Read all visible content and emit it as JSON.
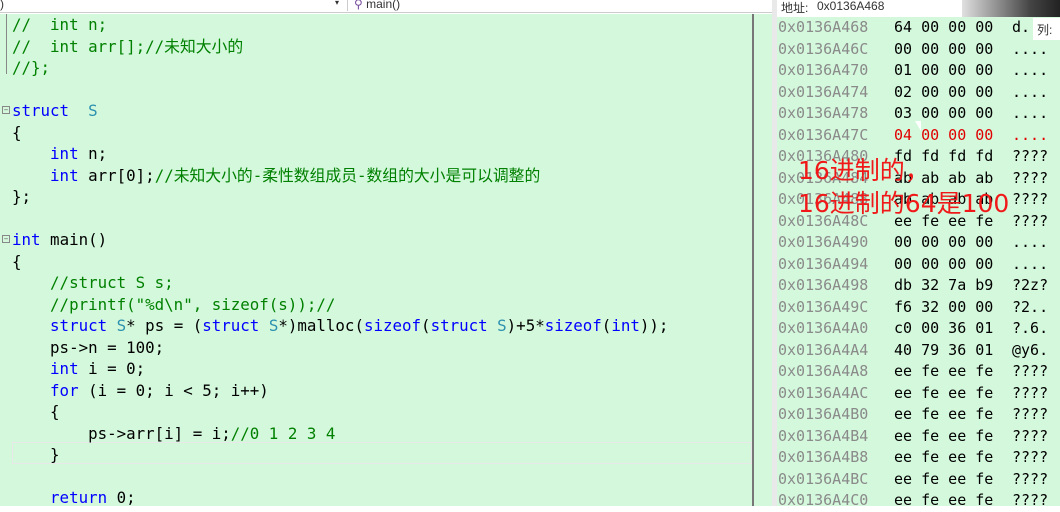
{
  "nav": {
    "left_value": ")",
    "right_value": "main()"
  },
  "code": [
    [
      [
        "cm",
        "//  int n;"
      ]
    ],
    [
      [
        "cm",
        "//  int arr[];//未知大小的"
      ]
    ],
    [
      [
        "cm",
        "//};"
      ]
    ],
    [],
    [
      [
        "kw",
        "struct"
      ],
      [
        "",
        "  "
      ],
      [
        "ty",
        "S"
      ]
    ],
    [
      [
        "",
        "{"
      ]
    ],
    [
      [
        "",
        "    "
      ],
      [
        "kw",
        "int"
      ],
      [
        "",
        " n;"
      ]
    ],
    [
      [
        "",
        "    "
      ],
      [
        "kw",
        "int"
      ],
      [
        "",
        " arr[0];"
      ],
      [
        "cm",
        "//未知大小的-柔性数组成员-数组的大小是可以调整的"
      ]
    ],
    [
      [
        "",
        "};"
      ]
    ],
    [],
    [
      [
        "kw",
        "int"
      ],
      [
        "",
        " main()"
      ]
    ],
    [
      [
        "",
        "{"
      ]
    ],
    [
      [
        "",
        "    "
      ],
      [
        "cm",
        "//struct S s;"
      ]
    ],
    [
      [
        "",
        "    "
      ],
      [
        "cm",
        "//printf(\"%d\\n\", sizeof(s));//"
      ]
    ],
    [
      [
        "",
        "    "
      ],
      [
        "kw",
        "struct"
      ],
      [
        "",
        " "
      ],
      [
        "ty",
        "S"
      ],
      [
        "",
        "* ps = ("
      ],
      [
        "kw",
        "struct"
      ],
      [
        "",
        " "
      ],
      [
        "ty",
        "S"
      ],
      [
        "",
        "*)malloc("
      ],
      [
        "kw",
        "sizeof"
      ],
      [
        "",
        "("
      ],
      [
        "kw",
        "struct"
      ],
      [
        "",
        " "
      ],
      [
        "ty",
        "S"
      ],
      [
        "",
        ")+5*"
      ],
      [
        "kw",
        "sizeof"
      ],
      [
        "",
        "("
      ],
      [
        "kw",
        "int"
      ],
      [
        "",
        "));"
      ]
    ],
    [
      [
        "",
        "    ps->n = 100;"
      ]
    ],
    [
      [
        "",
        "    "
      ],
      [
        "kw",
        "int"
      ],
      [
        "",
        " i = 0;"
      ]
    ],
    [
      [
        "",
        "    "
      ],
      [
        "kw",
        "for"
      ],
      [
        "",
        " (i = 0; i < 5; i++)"
      ]
    ],
    [
      [
        "",
        "    {"
      ]
    ],
    [
      [
        "",
        "        ps->arr[i] = i;"
      ],
      [
        "cm",
        "//0 1 2 3 4"
      ]
    ],
    [
      [
        "",
        "    }"
      ]
    ],
    [],
    [
      [
        "",
        "    "
      ],
      [
        "kw",
        "return"
      ],
      [
        "",
        " 0;"
      ]
    ]
  ],
  "memory": {
    "address_label": "地址:",
    "address_value": "0x0136A468",
    "column_label": "列:",
    "rows": [
      {
        "addr": "0x0136A468",
        "hex": "64 00 00 00",
        "ascii": "d..."
      },
      {
        "addr": "0x0136A46C",
        "hex": "00 00 00 00",
        "ascii": "...."
      },
      {
        "addr": "0x0136A470",
        "hex": "01 00 00 00",
        "ascii": "...."
      },
      {
        "addr": "0x0136A474",
        "hex": "02 00 00 00",
        "ascii": "...."
      },
      {
        "addr": "0x0136A478",
        "hex": "03 00 00 00",
        "ascii": "...."
      },
      {
        "addr": "0x0136A47C",
        "hex": "04 00 00 00",
        "ascii": "....",
        "changed": true
      },
      {
        "addr": "0x0136A480",
        "hex": "fd fd fd fd",
        "ascii": "????"
      },
      {
        "addr": "0x0136A484",
        "hex": "ab ab ab ab",
        "ascii": "????"
      },
      {
        "addr": "0x0136A488",
        "hex": "ab ab ab ab",
        "ascii": "????"
      },
      {
        "addr": "0x0136A48C",
        "hex": "ee fe ee fe",
        "ascii": "????"
      },
      {
        "addr": "0x0136A490",
        "hex": "00 00 00 00",
        "ascii": "...."
      },
      {
        "addr": "0x0136A494",
        "hex": "00 00 00 00",
        "ascii": "...."
      },
      {
        "addr": "0x0136A498",
        "hex": "db 32 7a b9",
        "ascii": "?2z?"
      },
      {
        "addr": "0x0136A49C",
        "hex": "f6 32 00 00",
        "ascii": "?2.."
      },
      {
        "addr": "0x0136A4A0",
        "hex": "c0 00 36 01",
        "ascii": "?.6."
      },
      {
        "addr": "0x0136A4A4",
        "hex": "40 79 36 01",
        "ascii": "@y6."
      },
      {
        "addr": "0x0136A4A8",
        "hex": "ee fe ee fe",
        "ascii": "????"
      },
      {
        "addr": "0x0136A4AC",
        "hex": "ee fe ee fe",
        "ascii": "????"
      },
      {
        "addr": "0x0136A4B0",
        "hex": "ee fe ee fe",
        "ascii": "????"
      },
      {
        "addr": "0x0136A4B4",
        "hex": "ee fe ee fe",
        "ascii": "????"
      },
      {
        "addr": "0x0136A4B8",
        "hex": "ee fe ee fe",
        "ascii": "????"
      },
      {
        "addr": "0x0136A4BC",
        "hex": "ee fe ee fe",
        "ascii": "????"
      },
      {
        "addr": "0x0136A4C0",
        "hex": "ee fe ee fe",
        "ascii": "????"
      }
    ]
  },
  "overlay": {
    "line1": "16进制的，",
    "line2": "16进制的64是100"
  },
  "colors": {
    "changed": "#e00000",
    "overlay": "#f01818",
    "background": "#d4f8dc"
  }
}
